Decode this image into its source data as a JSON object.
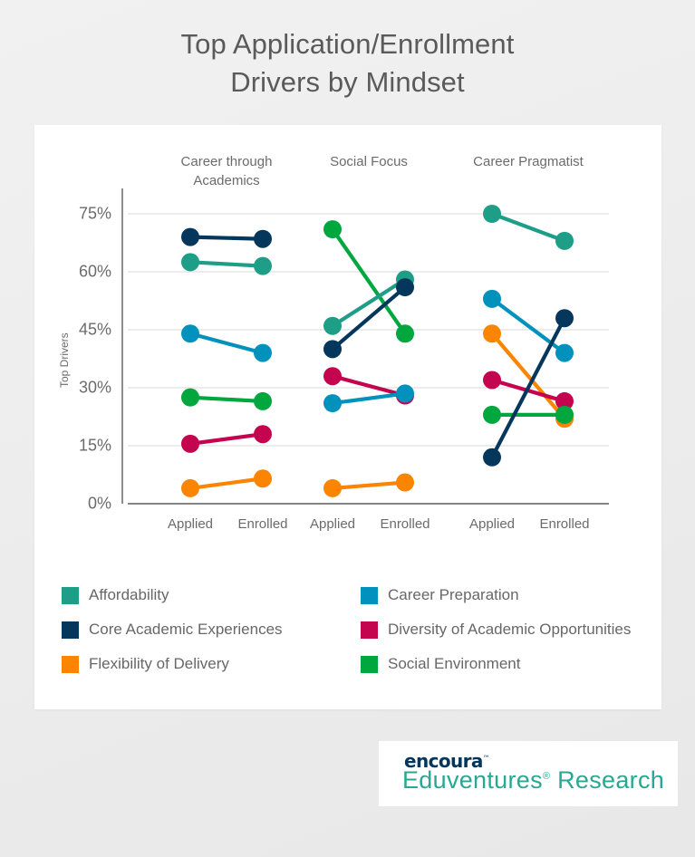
{
  "title": "Top Application/Enrollment\nDrivers by Mindset",
  "footer": {
    "brand": "encoura",
    "trademark": "™",
    "product": "Eduventures",
    "registered": "®",
    "product_suffix": " Research"
  },
  "legend": [
    {
      "label": "Affordability",
      "color": "#1E9E87"
    },
    {
      "label": "Career Preparation",
      "color": "#0092BC"
    },
    {
      "label": "Core Academic Experiences",
      "color": "#05375D"
    },
    {
      "label": "Diversity of Academic Opportunities",
      "color": "#C4044F"
    },
    {
      "label": "Flexibility of Delivery",
      "color": "#FB8400"
    },
    {
      "label": "Social Environment",
      "color": "#00A63E"
    }
  ],
  "chart_data": {
    "type": "line",
    "title": "Top Application/Enrollment Drivers by Mindset",
    "xlabel": "",
    "ylabel": "Top Drivers",
    "ylim": [
      0,
      80
    ],
    "yticks": [
      0,
      15,
      30,
      45,
      60,
      75
    ],
    "ytick_labels": [
      "0%",
      "15%",
      "30%",
      "45%",
      "60%",
      "75%"
    ],
    "grid": "horizontal",
    "legend_position": "bottom",
    "x": [
      "Applied",
      "Enrolled"
    ],
    "panels": [
      {
        "name": "Career through Academics",
        "title": "Career through\nAcademics",
        "series": [
          {
            "name": "Core Academic Experiences",
            "color": "#05375D",
            "values": [
              69.0,
              68.5
            ]
          },
          {
            "name": "Affordability",
            "color": "#1E9E87",
            "values": [
              62.5,
              61.5
            ]
          },
          {
            "name": "Career Preparation",
            "color": "#0092BC",
            "values": [
              44.0,
              39.0
            ]
          },
          {
            "name": "Social Environment",
            "color": "#00A63E",
            "values": [
              27.5,
              26.5
            ]
          },
          {
            "name": "Diversity of Academic Opportunities",
            "color": "#C4044F",
            "values": [
              15.5,
              18.0
            ]
          },
          {
            "name": "Flexibility of Delivery",
            "color": "#FB8400",
            "values": [
              4.0,
              6.5
            ]
          }
        ]
      },
      {
        "name": "Social Focus",
        "title": "Social Focus",
        "series": [
          {
            "name": "Social Environment",
            "color": "#00A63E",
            "values": [
              71.0,
              44.0
            ]
          },
          {
            "name": "Affordability",
            "color": "#1E9E87",
            "values": [
              46.0,
              58.0
            ]
          },
          {
            "name": "Core Academic Experiences",
            "color": "#05375D",
            "values": [
              40.0,
              56.0
            ]
          },
          {
            "name": "Diversity of Academic Opportunities",
            "color": "#C4044F",
            "values": [
              33.0,
              28.0
            ]
          },
          {
            "name": "Career Preparation",
            "color": "#0092BC",
            "values": [
              26.0,
              28.5
            ]
          },
          {
            "name": "Flexibility of Delivery",
            "color": "#FB8400",
            "values": [
              4.0,
              5.5
            ]
          }
        ]
      },
      {
        "name": "Career Pragmatist",
        "title": "Career Pragmatist",
        "series": [
          {
            "name": "Affordability",
            "color": "#1E9E87",
            "values": [
              75.0,
              68.0
            ]
          },
          {
            "name": "Career Preparation",
            "color": "#0092BC",
            "values": [
              53.0,
              39.0
            ]
          },
          {
            "name": "Flexibility of Delivery",
            "color": "#FB8400",
            "values": [
              44.0,
              22.0
            ]
          },
          {
            "name": "Diversity of Academic Opportunities",
            "color": "#C4044F",
            "values": [
              32.0,
              26.5
            ]
          },
          {
            "name": "Social Environment",
            "color": "#00A63E",
            "values": [
              23.0,
              23.0
            ]
          },
          {
            "name": "Core Academic Experiences",
            "color": "#05375D",
            "values": [
              12.0,
              48.0
            ]
          }
        ]
      }
    ]
  }
}
